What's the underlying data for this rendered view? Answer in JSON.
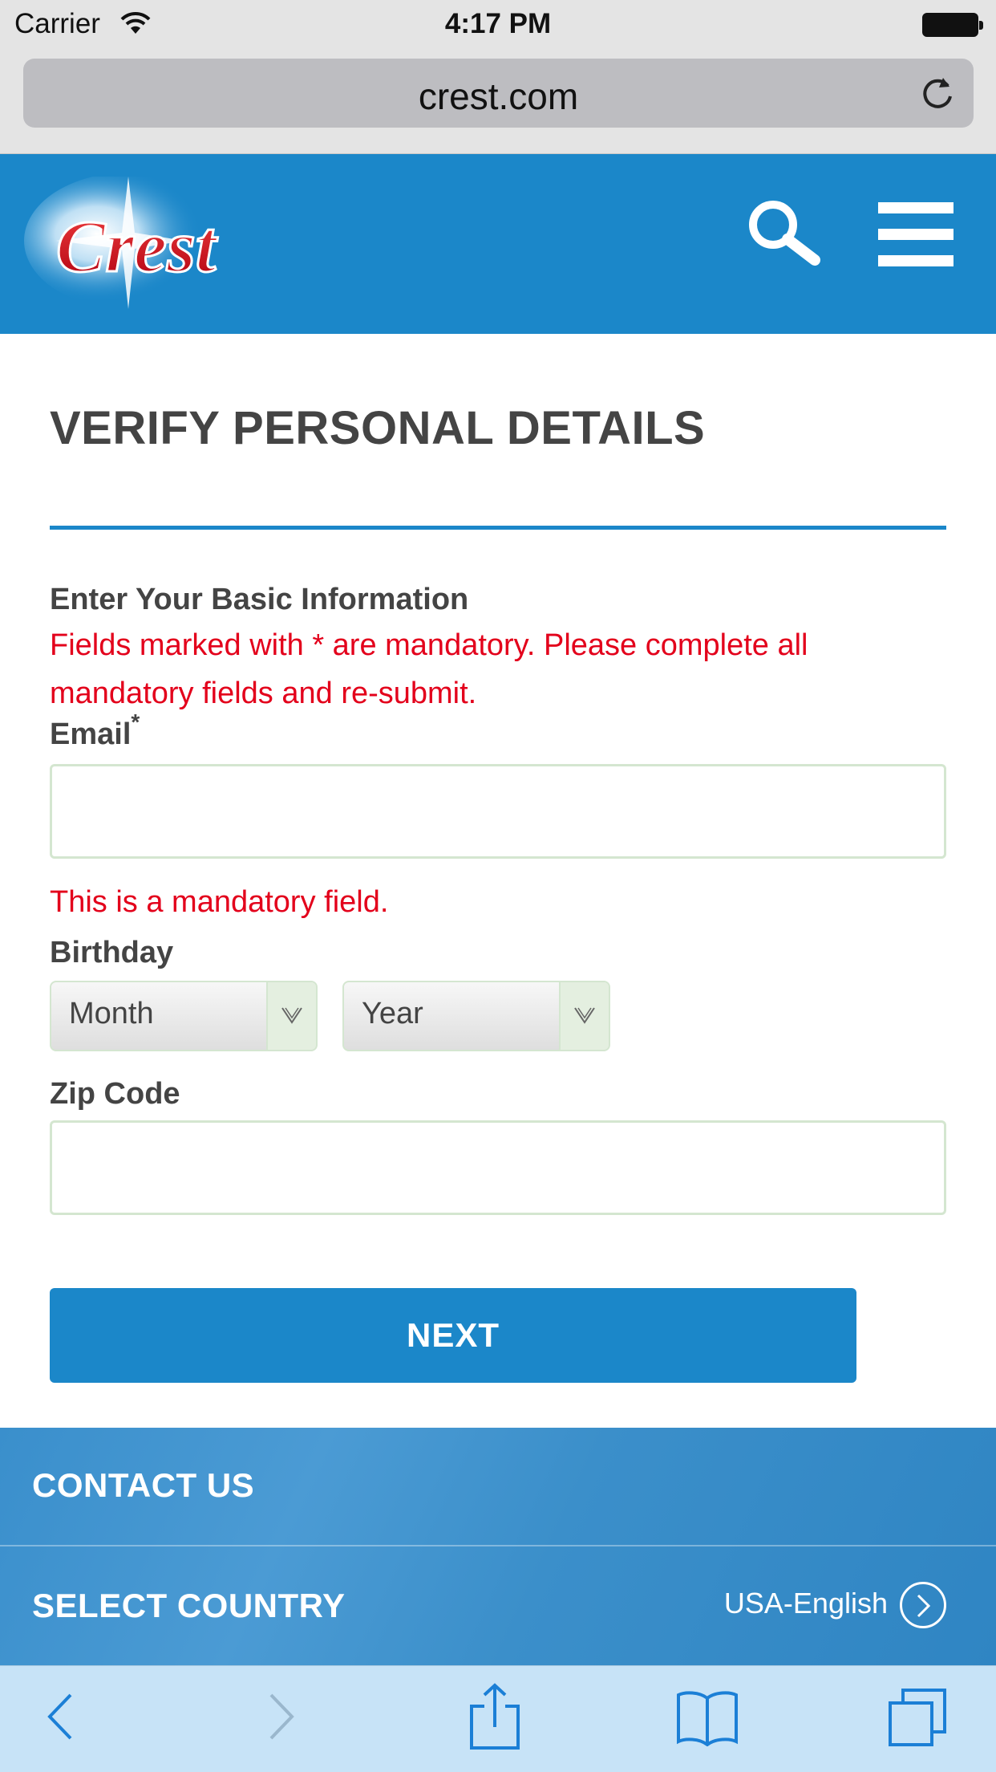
{
  "status_bar": {
    "carrier": "Carrier",
    "time": "4:17 PM"
  },
  "browser": {
    "url": "crest.com"
  },
  "header": {
    "logo_text": "Crest"
  },
  "form": {
    "title": "VERIFY PERSONAL DETAILS",
    "section_label": "Enter Your Basic Information",
    "error_message": "Fields marked with * are mandatory. Please complete all mandatory fields and re-submit.",
    "email_label": "Email",
    "required_mark": "*",
    "email_value": "",
    "email_error": "This is a mandatory field.",
    "birthday_label": "Birthday",
    "month_value": "Month",
    "year_value": "Year",
    "zip_label": "Zip Code",
    "zip_value": "",
    "next_label": "NEXT"
  },
  "footer": {
    "contact_label": "CONTACT US",
    "country_label": "SELECT COUNTRY",
    "country_value": "USA-English"
  },
  "colors": {
    "brand_blue": "#1b87c9",
    "error_red": "#e3001b",
    "text_gray": "#444444"
  }
}
